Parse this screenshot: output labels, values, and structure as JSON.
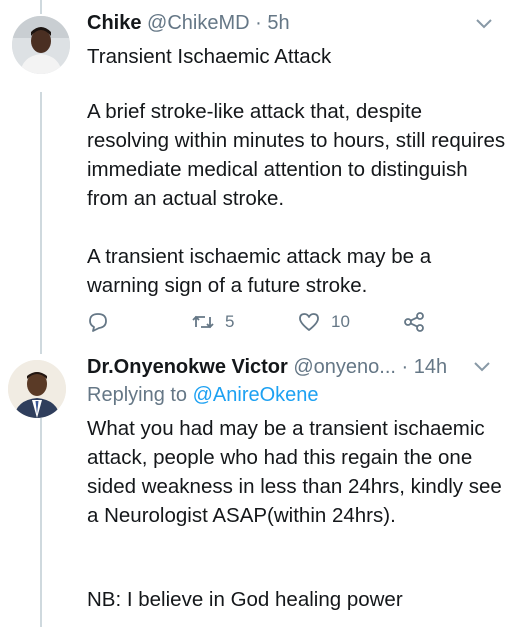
{
  "tweet1": {
    "name": "Chike",
    "handle": "@ChikeMD",
    "separator": "·",
    "time": "5h",
    "title": "Transient Ischaemic Attack",
    "paragraph1": "A brief stroke-like attack that, despite resolving within minutes to hours, still requires immediate medical attention to distinguish from an actual stroke.",
    "paragraph2": "A transient ischaemic attack may be a warning sign of a future stroke.",
    "retweets": "5",
    "likes": "10"
  },
  "tweet2": {
    "name": "Dr.Onyenokwe Victor",
    "handle": "@onyeno...",
    "separator": "·",
    "time": "14h",
    "replying_prefix": "Replying to",
    "replying_to": "@AnireOkene",
    "paragraph1": "What you had may be a transient ischaemic attack, people who had this regain the one sided weakness in less than 24hrs, kindly see a Neurologist ASAP(within 24hrs).",
    "paragraph2": "NB: I believe in God healing power"
  },
  "icons": {
    "reply": "reply-icon",
    "retweet": "retweet-icon",
    "like": "heart-icon",
    "share": "share-icon",
    "menu": "chevron-down-icon"
  },
  "colors": {
    "text": "#14171a",
    "secondary": "#657786",
    "link": "#1da1f2",
    "thread_line": "#cfd9de"
  }
}
